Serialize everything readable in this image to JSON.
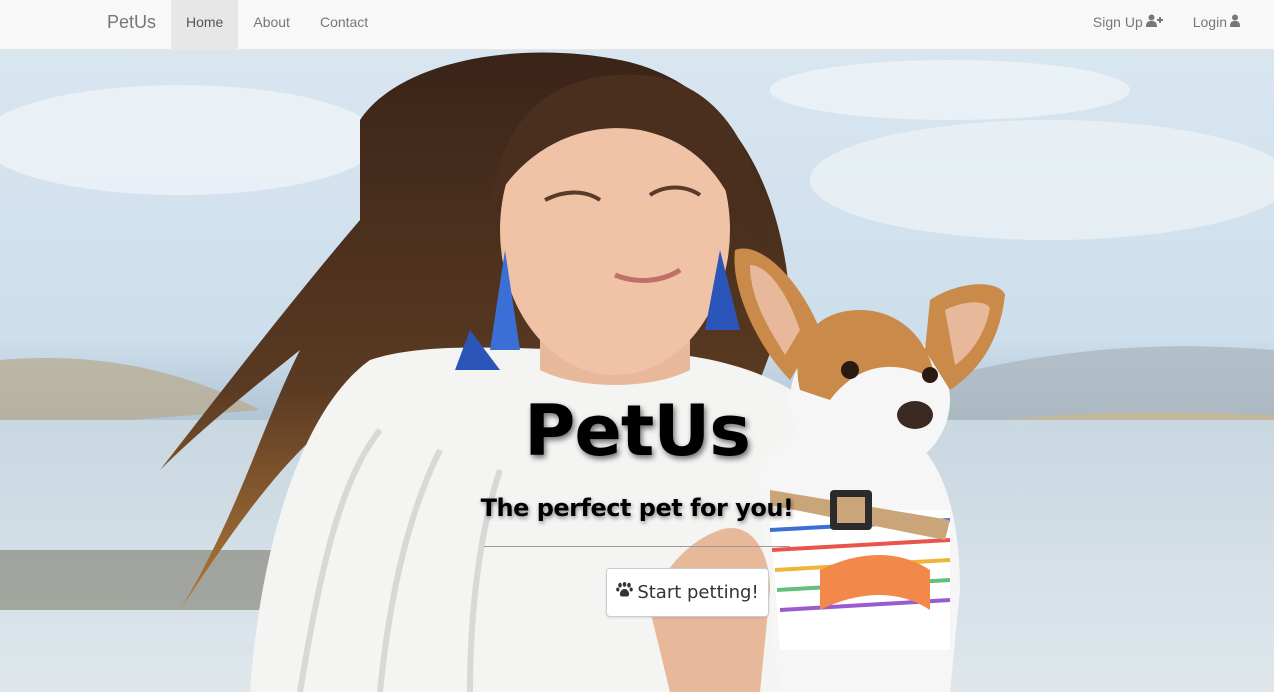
{
  "navbar": {
    "brand": "PetUs",
    "links": [
      {
        "label": "Home",
        "active": true
      },
      {
        "label": "About",
        "active": false
      },
      {
        "label": "Contact",
        "active": false
      }
    ],
    "right_links": [
      {
        "label": "Sign Up",
        "icon": "user-plus-icon"
      },
      {
        "label": "Login",
        "icon": "user-icon"
      }
    ]
  },
  "hero": {
    "title": "PetUs",
    "subtitle": "The perfect pet for you!",
    "cta": {
      "label": "Start petting!",
      "icon": "paw-icon"
    },
    "background": "photo-woman-holding-chihuahua"
  },
  "colors": {
    "navbar_bg": "#f8f8f8",
    "active_bg": "#e7e7e7",
    "link": "#777777"
  }
}
